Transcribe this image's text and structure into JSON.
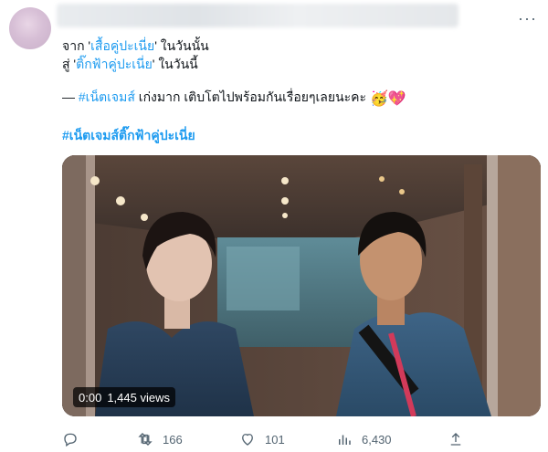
{
  "tweet": {
    "line1_prefix": "จาก '",
    "line1_link": "เสื้อคู่ปะเนี่ย",
    "line1_suffix": "' ในวันนั้น",
    "line2_prefix": "สู่ '",
    "line2_link": "ติ๊กฟ้าคู่ปะเนี่ย",
    "line2_suffix": "' ในวันนี้",
    "line3_dash": "— ",
    "line3_hashtag": "#เน็ตเจมส์",
    "line3_text": " เก่งมาก เติบโตไปพร้อมกันเรื่อยๆเลยนะคะ ",
    "line3_emoji": "🥳💖",
    "hashtag": "#เน็ตเจมส์ติ๊กฟ้าคู่ปะเนี่ย"
  },
  "video": {
    "time": "0:00",
    "views": "1,445 views"
  },
  "actions": {
    "reply_icon": "reply-icon",
    "retweet_count": "166",
    "like_count": "101",
    "views_count": "6,430"
  },
  "colors": {
    "link": "#1d9bf0",
    "muted": "#536471",
    "text": "#0f1419"
  }
}
